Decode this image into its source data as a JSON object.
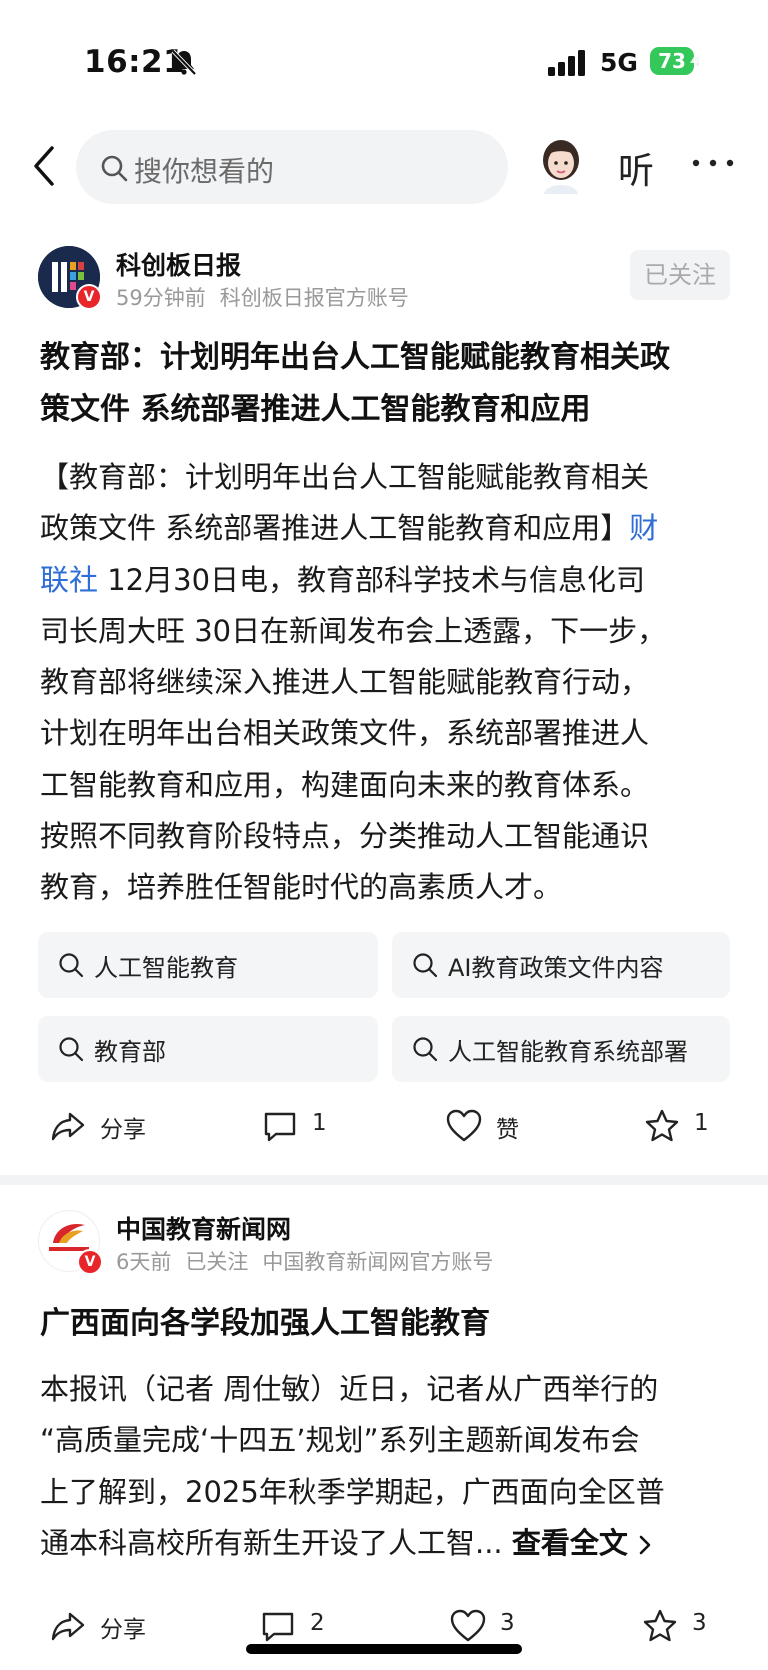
{
  "status_bar": {
    "time": "16:21",
    "network": "5G",
    "battery": "73"
  },
  "nav": {
    "search_placeholder": "搜你想看的",
    "listen_label": "听"
  },
  "post1": {
    "author": "科创板日报",
    "time": "59分钟前",
    "account": "科创板日报官方账号",
    "follow_label": "已关注",
    "title_line1": "教育部：计划明年出台人工智能赋能教育相关政",
    "title_line2": "策文件 系统部署推进人工智能教育和应用",
    "body_line1": "【教育部：计划明年出台人工智能赋能教育相关",
    "body_line2": "政策文件 系统部署推进人工智能教育和应用】",
    "body_link_part1": "财",
    "body_link_part2": "联社",
    "body_line3_rest": " 12月30日电，教育部科学技术与信息化司",
    "body_line4": "司长周大旺 30日在新闻发布会上透露，下一步，",
    "body_line5": "教育部将继续深入推进人工智能赋能教育行动，",
    "body_line6": "计划在明年出台相关政策文件，系统部署推进人",
    "body_line7": "工智能教育和应用，构建面向未来的教育体系。",
    "body_line8": "按照不同教育阶段特点，分类推动人工智能通识",
    "body_line9": "教育，培养胜任智能时代的高素质人才。",
    "chips": [
      "人工智能教育",
      "AI教育政策文件内容",
      "教育部",
      "人工智能教育系统部署"
    ],
    "actions": {
      "share": "分享",
      "comments": "1",
      "like": "赞",
      "favorites": "1"
    }
  },
  "post2": {
    "author": "中国教育新闻网",
    "time": "6天前",
    "followed": "已关注",
    "account": "中国教育新闻网官方账号",
    "title": "广西面向各学段加强人工智能教育",
    "body_line1": "本报讯（记者 周仕敏）近日，记者从广西举行的",
    "body_line2": "“高质量完成‘十四五’规划”系列主题新闻发布会",
    "body_line3": "上了解到，2025年秋季学期起，广西面向全区普",
    "body_line4": "通本科高校所有新生开设了人工智...",
    "read_more": "查看全文",
    "actions": {
      "share": "分享",
      "comments": "2",
      "likes": "3",
      "favorites": "3"
    }
  },
  "colors": {
    "accent_link": "#2f6ed6",
    "verify_badge": "#e8262a",
    "battery": "#34c759"
  }
}
